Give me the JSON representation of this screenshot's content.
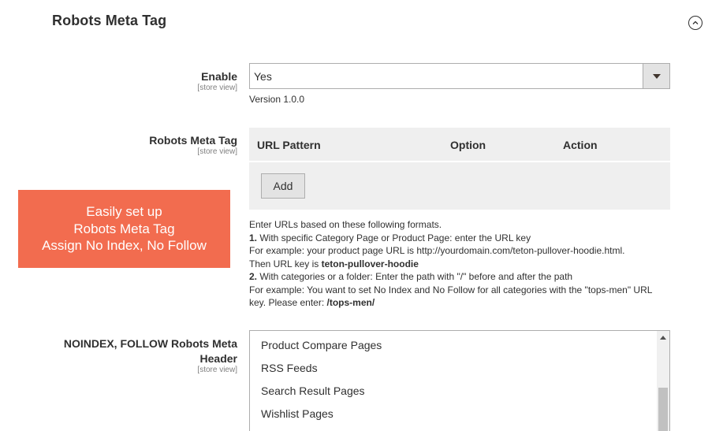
{
  "section": {
    "title": "Robots Meta Tag"
  },
  "enable": {
    "label": "Enable",
    "scope": "[store view]",
    "value": "Yes",
    "version": "Version 1.0.0"
  },
  "robots_meta_tag": {
    "label": "Robots Meta Tag",
    "scope": "[store view]",
    "columns": [
      "URL Pattern",
      "Option",
      "Action"
    ],
    "add_label": "Add",
    "note": {
      "line1": "Enter URLs based on these following formats.",
      "line2_num": "1.",
      "line2": " With specific Category Page or Product Page: enter the URL key",
      "line3": "For example: your product page URL is http://yourdomain.com/teton-pullover-hoodie.html.",
      "line4_pre": "Then URL key is ",
      "line4_bold": "teton-pullover-hoodie",
      "line5_num": "2.",
      "line5": " With categories or a folder: Enter the path with \"/\" before and after the path",
      "line6": "For example: You want to set No Index and No Follow for all categories with the \"tops-men\" URL",
      "line7_pre": "key. Please enter: ",
      "line7_bold": "/tops-men/"
    }
  },
  "banner": {
    "line1": "Easily set up",
    "line2": "Robots Meta Tag",
    "line3": "Assign No Index, No Follow"
  },
  "noindex_follow": {
    "label_line1": "NOINDEX, FOLLOW Robots Meta",
    "label_line2": "Header",
    "scope": "[store view]",
    "options": [
      "Product Compare Pages",
      "RSS Feeds",
      "Search Result Pages",
      "Wishlist Pages"
    ]
  },
  "colors": {
    "banner_bg": "#f26c4f",
    "grid_bg": "#efefef",
    "button_bg": "#e3e3e3",
    "border": "#adadad",
    "text": "#303030",
    "scope_text": "#808080"
  },
  "icons": {
    "collapse": "chevron-up-circle-icon",
    "select_arrow": "caret-down-icon",
    "scroll_up": "scroll-up-arrow-icon"
  }
}
